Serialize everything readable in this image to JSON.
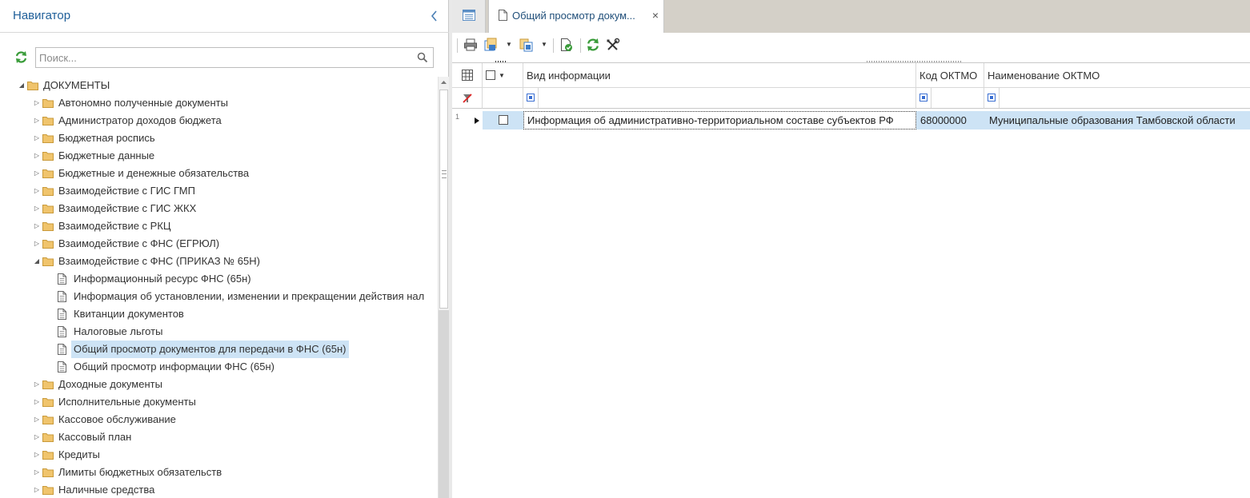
{
  "navigator": {
    "title": "Навигатор",
    "search_placeholder": "Поиск...",
    "tree": [
      {
        "label": "ДОКУМЕНТЫ",
        "level": 0,
        "expanded": true,
        "type": "folder"
      },
      {
        "label": "Автономно полученные документы",
        "level": 1,
        "expanded": false,
        "type": "folder"
      },
      {
        "label": "Администратор доходов бюджета",
        "level": 1,
        "expanded": false,
        "type": "folder"
      },
      {
        "label": "Бюджетная роспись",
        "level": 1,
        "expanded": false,
        "type": "folder"
      },
      {
        "label": "Бюджетные данные",
        "level": 1,
        "expanded": false,
        "type": "folder"
      },
      {
        "label": "Бюджетные и денежные обязательства",
        "level": 1,
        "expanded": false,
        "type": "folder"
      },
      {
        "label": "Взаимодействие с ГИС ГМП",
        "level": 1,
        "expanded": false,
        "type": "folder"
      },
      {
        "label": "Взаимодействие с ГИС ЖКХ",
        "level": 1,
        "expanded": false,
        "type": "folder"
      },
      {
        "label": "Взаимодействие с РКЦ",
        "level": 1,
        "expanded": false,
        "type": "folder"
      },
      {
        "label": "Взаимодействие с ФНС (ЕГРЮЛ)",
        "level": 1,
        "expanded": false,
        "type": "folder"
      },
      {
        "label": "Взаимодействие с ФНС (ПРИКАЗ № 65Н)",
        "level": 1,
        "expanded": true,
        "type": "folder"
      },
      {
        "label": "Информационный ресурс ФНС (65н)",
        "level": 2,
        "type": "doc"
      },
      {
        "label": "Информация об установлении, изменении и прекращении действия нал",
        "level": 2,
        "type": "doc"
      },
      {
        "label": "Квитанции документов",
        "level": 2,
        "type": "doc"
      },
      {
        "label": "Налоговые льготы",
        "level": 2,
        "type": "doc"
      },
      {
        "label": "Общий просмотр документов для передачи в ФНС (65н)",
        "level": 2,
        "type": "doc",
        "selected": true
      },
      {
        "label": "Общий просмотр информации ФНС (65н)",
        "level": 2,
        "type": "doc"
      },
      {
        "label": "Доходные документы",
        "level": 1,
        "expanded": false,
        "type": "folder"
      },
      {
        "label": "Исполнительные документы",
        "level": 1,
        "expanded": false,
        "type": "folder"
      },
      {
        "label": "Кассовое обслуживание",
        "level": 1,
        "expanded": false,
        "type": "folder"
      },
      {
        "label": "Кассовый план",
        "level": 1,
        "expanded": false,
        "type": "folder"
      },
      {
        "label": "Кредиты",
        "level": 1,
        "expanded": false,
        "type": "folder"
      },
      {
        "label": "Лимиты бюджетных обязательств",
        "level": 1,
        "expanded": false,
        "type": "folder"
      },
      {
        "label": "Наличные средства",
        "level": 1,
        "expanded": false,
        "type": "folder"
      }
    ]
  },
  "tabs": {
    "active_label": "Общий просмотр докум...",
    "close_glyph": "×"
  },
  "grid": {
    "columns": [
      "Вид информации",
      "Код ОКТМО",
      "Наименование ОКТМО"
    ],
    "rows": [
      {
        "num": "1",
        "vid": "Информация об административно-территориальном составе субъектов РФ",
        "kod": "68000000",
        "name": "Муниципальные образования Тамбовской области"
      }
    ]
  },
  "colors": {
    "accent": "#1f5f99",
    "selection": "#cde3f5",
    "tabbar": "#d4d0c8",
    "refresh_green": "#3a9c3a",
    "folder": "#f0c46c"
  }
}
